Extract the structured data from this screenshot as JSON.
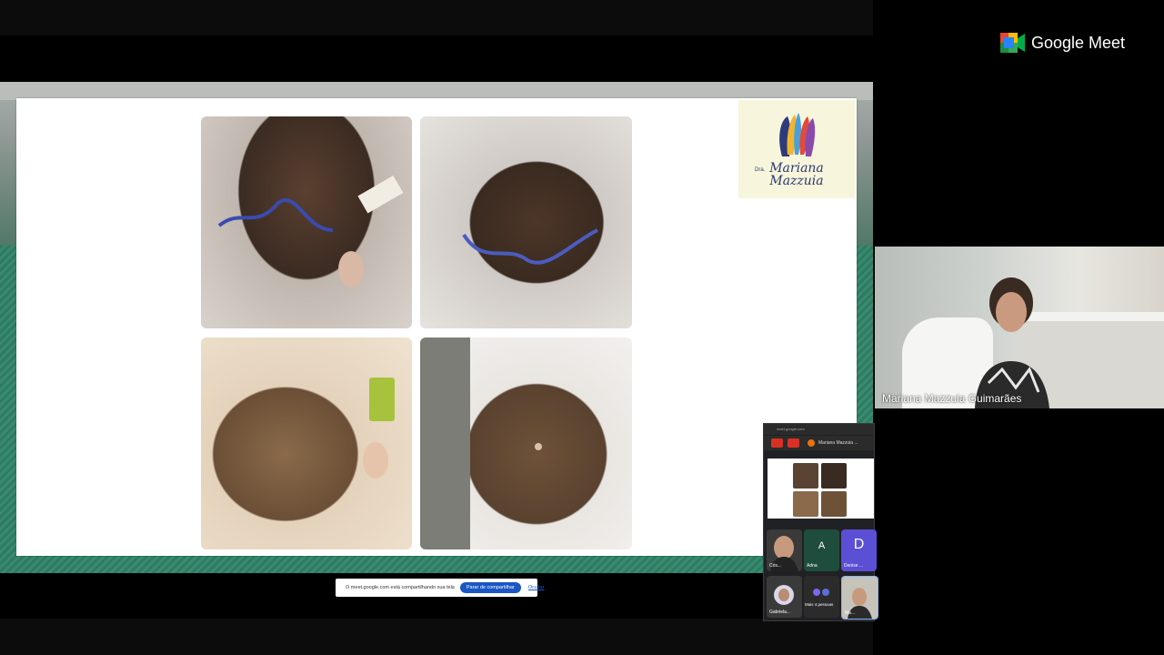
{
  "app": {
    "name": "Google Meet"
  },
  "slide": {
    "logo": {
      "prefix": "Dra.",
      "line1": "Mariana",
      "line2": "Mazzuia",
      "mark_colors": [
        "#2f3a7a",
        "#e24a3a",
        "#f2b530",
        "#4aa1d8",
        "#8a4aa8"
      ]
    }
  },
  "speaker": {
    "name": "Mariana Mazzuia Guimarães"
  },
  "share_banner": {
    "text": "O meet.google.com está compartilhando sua tela",
    "stop_label": "Parar de compartilhar",
    "hide_label": "Ocultar"
  },
  "mini_window": {
    "url": "meet.google.com",
    "tab_title": "Mariana Mazzuia ...",
    "participants": [
      {
        "label": "Cris...",
        "initial": "",
        "color": "#3a3a3a"
      },
      {
        "label": "Adna",
        "initial": "A",
        "color": "#1e4d3d"
      },
      {
        "label": "Denise ...",
        "initial": "D",
        "color": "#5b4fd6"
      },
      {
        "label": "Gabriela...",
        "initial": "",
        "color": "#3a3a3a"
      },
      {
        "label": "Mais 4 pessoas",
        "initial": "",
        "color": "#2b2b2b"
      },
      {
        "label": "Ma...",
        "initial": "",
        "color": "#3a3a3a"
      }
    ]
  },
  "colors": {
    "accent": "#1a56c4",
    "meet_bg": "#000000",
    "slide_bg": "#ffffff"
  }
}
